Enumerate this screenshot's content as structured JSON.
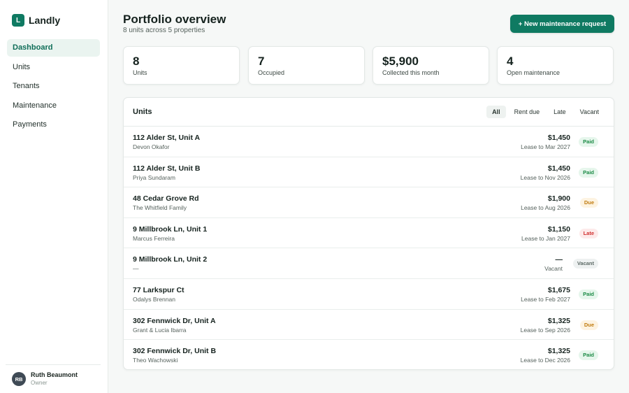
{
  "brand": {
    "logo_letter": "L",
    "name": "Landly"
  },
  "nav": [
    {
      "label": "Dashboard",
      "active": true
    },
    {
      "label": "Units"
    },
    {
      "label": "Tenants"
    },
    {
      "label": "Maintenance"
    },
    {
      "label": "Payments"
    }
  ],
  "user": {
    "initials": "RB",
    "name": "Ruth Beaumont",
    "role": "Owner"
  },
  "header": {
    "title": "Portfolio overview",
    "subtitle": "8 units across 5 properties",
    "new_request_label": "+ New maintenance request"
  },
  "stats": [
    {
      "value": "8",
      "label": "Units"
    },
    {
      "value": "7",
      "label": "Occupied"
    },
    {
      "value": "$5,900",
      "label": "Collected this month"
    },
    {
      "value": "4",
      "label": "Open maintenance"
    }
  ],
  "units_panel": {
    "title": "Units",
    "filters": [
      "All",
      "Rent due",
      "Late",
      "Vacant"
    ],
    "active_filter": "All",
    "rows": [
      {
        "address": "112 Alder St, Unit A",
        "tenant": "Devon Okafor",
        "rent": "$1,450",
        "lease": "Lease to Mar 2027",
        "status": "Paid"
      },
      {
        "address": "112 Alder St, Unit B",
        "tenant": "Priya Sundaram",
        "rent": "$1,450",
        "lease": "Lease to Nov 2026",
        "status": "Paid"
      },
      {
        "address": "48 Cedar Grove Rd",
        "tenant": "The Whitfield Family",
        "rent": "$1,900",
        "lease": "Lease to Aug 2026",
        "status": "Due"
      },
      {
        "address": "9 Millbrook Ln, Unit 1",
        "tenant": "Marcus Ferreira",
        "rent": "$1,150",
        "lease": "Lease to Jan 2027",
        "status": "Late"
      },
      {
        "address": "9 Millbrook Ln, Unit 2",
        "tenant": "—",
        "rent": "—",
        "lease": "Vacant",
        "status": "Vacant"
      },
      {
        "address": "77 Larkspur Ct",
        "tenant": "Odalys Brennan",
        "rent": "$1,675",
        "lease": "Lease to Feb 2027",
        "status": "Paid"
      },
      {
        "address": "302 Fennwick Dr, Unit A",
        "tenant": "Grant & Lucia Ibarra",
        "rent": "$1,325",
        "lease": "Lease to Sep 2026",
        "status": "Due"
      },
      {
        "address": "302 Fennwick Dr, Unit B",
        "tenant": "Theo Wachowski",
        "rent": "$1,325",
        "lease": "Lease to Dec 2026",
        "status": "Paid"
      }
    ]
  },
  "colors": {
    "accent": "#0f7a62",
    "paid": "#1a8a44",
    "due": "#c07a0c",
    "late": "#d0302f",
    "vacant": "#5d6a66"
  }
}
